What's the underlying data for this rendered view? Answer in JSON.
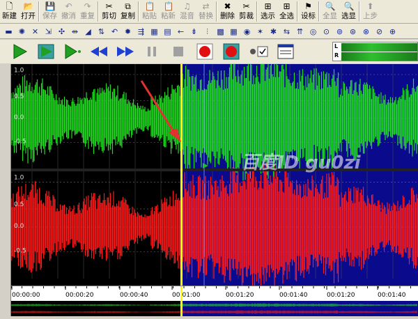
{
  "toolbar": {
    "buttons": [
      {
        "label": "新建",
        "enabled": true
      },
      {
        "label": "打开",
        "enabled": true
      },
      {
        "label": "保存",
        "enabled": false
      },
      {
        "label": "撤消",
        "enabled": false
      },
      {
        "label": "重复",
        "enabled": false
      },
      {
        "label": "剪切",
        "enabled": true
      },
      {
        "label": "复制",
        "enabled": true
      },
      {
        "label": "粘贴",
        "enabled": false
      },
      {
        "label": "粘新",
        "enabled": false
      },
      {
        "label": "混音",
        "enabled": false
      },
      {
        "label": "替换",
        "enabled": false
      },
      {
        "label": "删除",
        "enabled": true
      },
      {
        "label": "剪裁",
        "enabled": true
      },
      {
        "label": "选示",
        "enabled": true
      },
      {
        "label": "全选",
        "enabled": true
      },
      {
        "label": "设标",
        "enabled": true
      },
      {
        "label": "全显",
        "enabled": false
      },
      {
        "label": "选显",
        "enabled": true
      },
      {
        "label": "上步",
        "enabled": false
      }
    ]
  },
  "levels": {
    "left_label": "L",
    "right_label": "R"
  },
  "tracks": {
    "y_labels": [
      "1.0",
      "0.5",
      "0.0",
      "-0.5"
    ]
  },
  "ruler": {
    "ticks": [
      "00:00:00",
      "00:00:20",
      "00:00:40",
      "00:01:00",
      "00:01:20",
      "00:01:40",
      "00:01:20",
      "00:01:40"
    ]
  },
  "watermark": "百度ID gu0zi",
  "colors": {
    "unselected_bg": "#000000",
    "selected_bg": "#0a0a8c",
    "left_channel": "#22dd22",
    "right_channel": "#ff1a1a",
    "cursor": "#ffff00",
    "arrow": "#e33030"
  }
}
